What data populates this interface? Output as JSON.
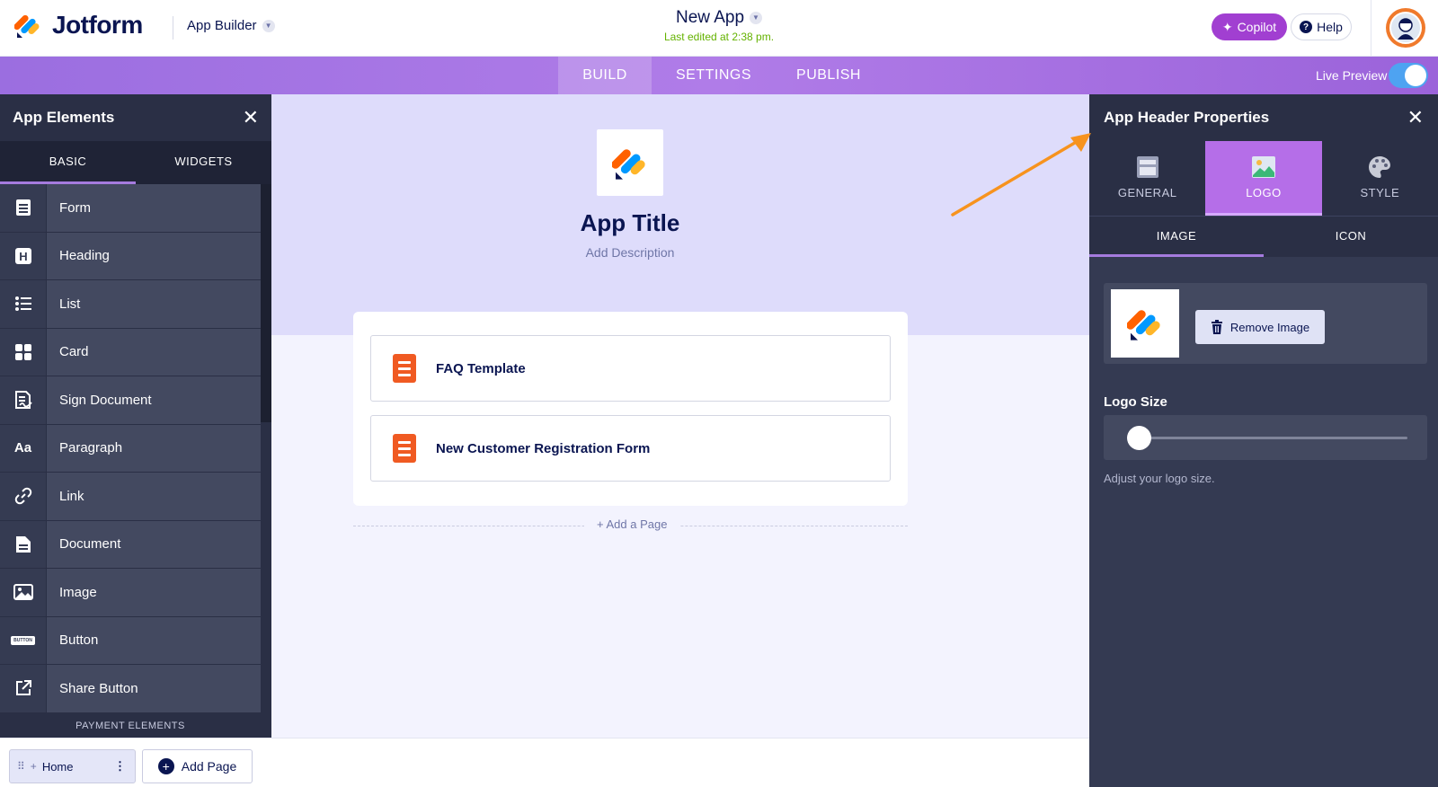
{
  "header": {
    "brand_name": "Jotform",
    "builder_label": "App Builder",
    "app_name": "New App",
    "last_edited": "Last edited at 2:38 pm.",
    "copilot_label": "Copilot",
    "help_label": "Help"
  },
  "nav": {
    "tabs": [
      {
        "label": "BUILD",
        "active": true
      },
      {
        "label": "SETTINGS",
        "active": false
      },
      {
        "label": "PUBLISH",
        "active": false
      }
    ],
    "live_preview_label": "Live Preview",
    "live_preview_on": true
  },
  "left_panel": {
    "title": "App Elements",
    "tabs": [
      {
        "label": "BASIC",
        "active": true
      },
      {
        "label": "WIDGETS",
        "active": false
      }
    ],
    "items": [
      {
        "label": "Form",
        "icon": "form-icon"
      },
      {
        "label": "Heading",
        "icon": "heading-icon"
      },
      {
        "label": "List",
        "icon": "list-icon"
      },
      {
        "label": "Card",
        "icon": "card-icon"
      },
      {
        "label": "Sign Document",
        "icon": "sign-document-icon"
      },
      {
        "label": "Paragraph",
        "icon": "paragraph-icon",
        "glyph": "Aa"
      },
      {
        "label": "Link",
        "icon": "link-icon"
      },
      {
        "label": "Document",
        "icon": "document-icon"
      },
      {
        "label": "Image",
        "icon": "image-icon"
      },
      {
        "label": "Button",
        "icon": "button-icon",
        "glyph": "BUTTON"
      },
      {
        "label": "Share Button",
        "icon": "share-icon"
      }
    ],
    "section_label": "PAYMENT ELEMENTS"
  },
  "canvas": {
    "app_title": "App Title",
    "description_placeholder": "Add Description",
    "pages": [
      {
        "label": "FAQ Template",
        "icon": "form-page-icon"
      },
      {
        "label": "New Customer Registration Form",
        "icon": "form-page-icon"
      }
    ],
    "add_page_link": "+ Add a Page"
  },
  "bottom_bar": {
    "home_tab": "Home",
    "add_page_button": "Add Page"
  },
  "right_panel": {
    "title": "App Header Properties",
    "tabs": [
      {
        "label": "GENERAL",
        "icon": "general-layout-icon",
        "active": false
      },
      {
        "label": "LOGO",
        "icon": "logo-image-icon",
        "active": true
      },
      {
        "label": "STYLE",
        "icon": "palette-icon",
        "active": false
      }
    ],
    "sub_tabs": [
      {
        "label": "IMAGE",
        "active": true
      },
      {
        "label": "ICON",
        "active": false
      }
    ],
    "remove_image_label": "Remove Image",
    "logo_size_label": "Logo Size",
    "logo_size_value": 0,
    "logo_size_hint": "Adjust your logo size."
  },
  "colors": {
    "accent_purple": "#a13fd1",
    "nav_purple": "#a872e4",
    "panel_dark": "#2a2f45",
    "page_icon_orange": "#f05a22",
    "last_edited_green": "#64b200",
    "annotation_arrow": "#f7931e"
  }
}
